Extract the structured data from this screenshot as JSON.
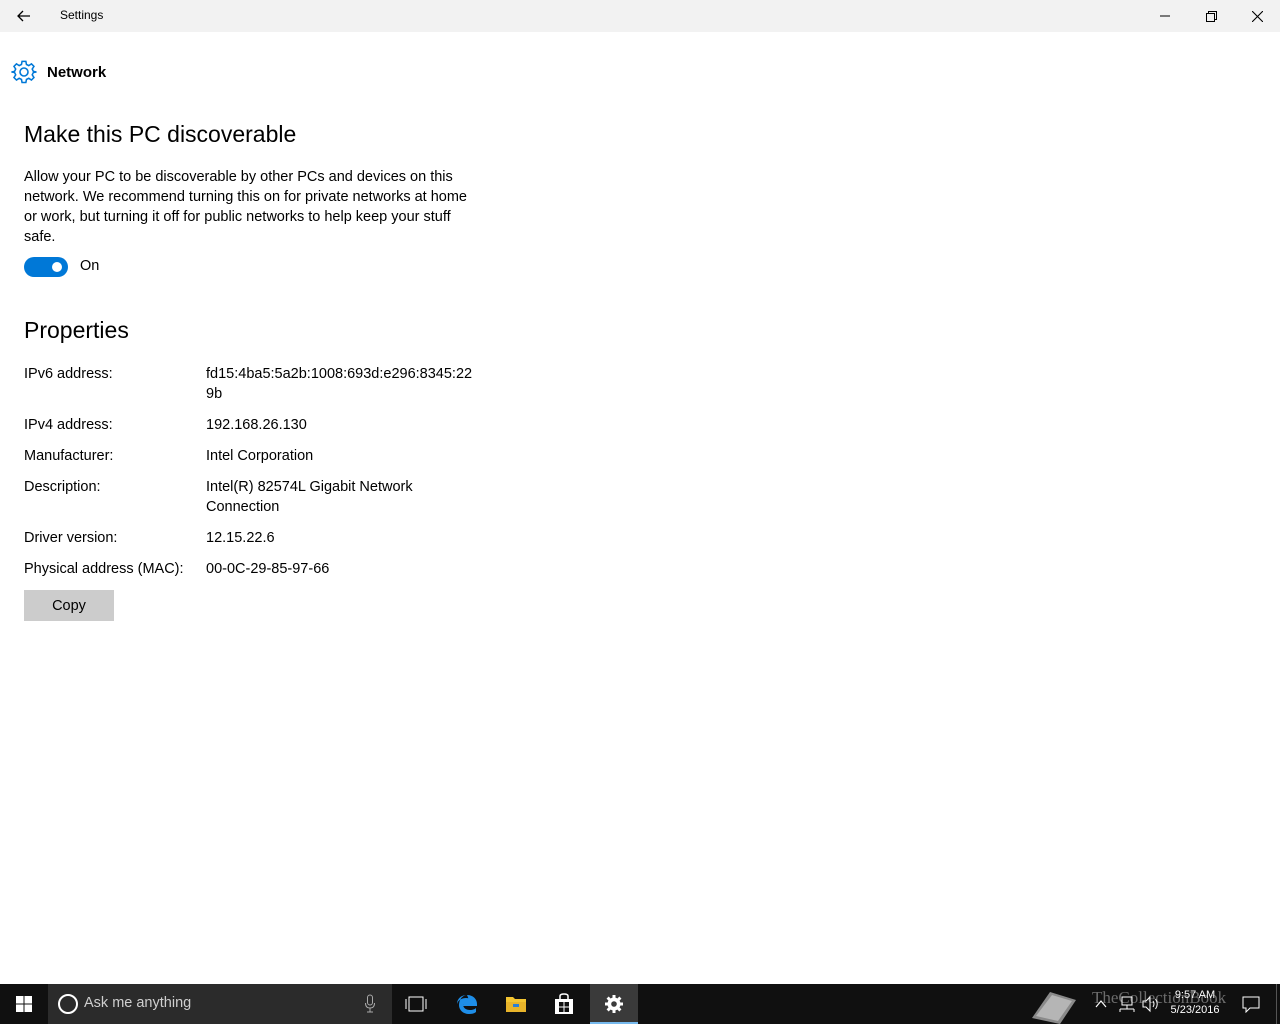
{
  "window": {
    "title": "Settings"
  },
  "header": {
    "label": "Network"
  },
  "discoverable": {
    "title": "Make this PC discoverable",
    "description": "Allow your PC to be discoverable by other PCs and devices on this network. We recommend turning this on for private networks at home or work, but turning it off for public networks to help keep your stuff safe.",
    "toggle_state": "On",
    "toggle_on": true,
    "accent_color": "#0078d7"
  },
  "properties": {
    "title": "Properties",
    "rows": [
      {
        "key": "IPv6 address:",
        "value": "fd15:4ba5:5a2b:1008:693d:e296:8345:229b"
      },
      {
        "key": "IPv4 address:",
        "value": "192.168.26.130"
      },
      {
        "key": "Manufacturer:",
        "value": "Intel Corporation"
      },
      {
        "key": "Description:",
        "value": "Intel(R) 82574L Gigabit Network Connection"
      },
      {
        "key": "Driver version:",
        "value": "12.15.22.6"
      },
      {
        "key": "Physical address (MAC):",
        "value": "00-0C-29-85-97-66"
      }
    ],
    "copy_label": "Copy"
  },
  "taskbar": {
    "search_placeholder": "Ask me anything",
    "watermark": "TheCollectionBook",
    "time": "9:57 AM",
    "date": "5/23/2016",
    "icons": [
      "windows-start-icon",
      "cortana-icon",
      "microphone-icon",
      "task-view-icon",
      "edge-icon",
      "file-explorer-icon",
      "store-icon",
      "settings-icon",
      "book-icon",
      "chevron-up-icon",
      "network-icon",
      "volume-icon",
      "action-center-icon"
    ]
  }
}
